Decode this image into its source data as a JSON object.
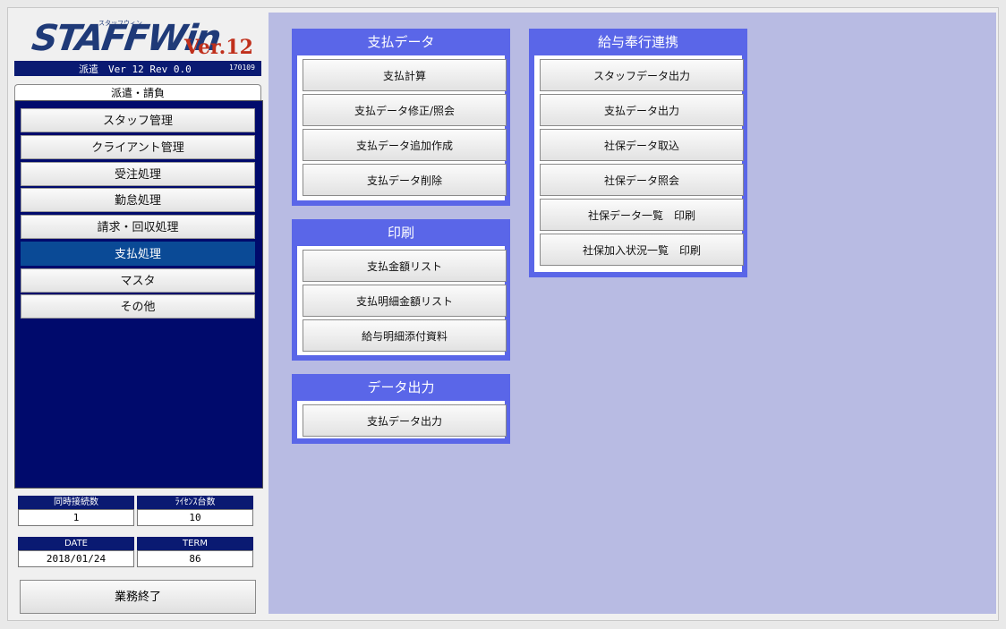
{
  "logo": {
    "main": "STAFFWin",
    "kana": "スタッフウィン",
    "version": "Ver.12"
  },
  "version_bar": {
    "text": "派遣　Ver 12 Rev 0.0",
    "build": "170109"
  },
  "sidebar": {
    "tab_label": "派遣・請負",
    "items": [
      {
        "label": "スタッフ管理"
      },
      {
        "label": "クライアント管理"
      },
      {
        "label": "受注処理"
      },
      {
        "label": "勤怠処理"
      },
      {
        "label": "請求・回収処理"
      },
      {
        "label": "支払処理"
      },
      {
        "label": "マスタ"
      },
      {
        "label": "その他"
      }
    ],
    "active_index": 5
  },
  "status": {
    "connections_label": "同時接続数",
    "connections_value": "1",
    "licenses_label": "ﾗｲｾﾝｽ台数",
    "licenses_value": "10",
    "date_label": "DATE",
    "date_value": "2018/01/24",
    "term_label": "TERM",
    "term_value": "86"
  },
  "exit_button": "業務終了",
  "groups": {
    "payment_data": {
      "title": "支払データ",
      "buttons": [
        "支払計算",
        "支払データ修正/照会",
        "支払データ追加作成",
        "支払データ削除"
      ]
    },
    "print": {
      "title": "印刷",
      "buttons": [
        "支払金額リスト",
        "支払明細金額リスト",
        "給与明細添付資料"
      ]
    },
    "data_output": {
      "title": "データ出力",
      "buttons": [
        "支払データ出力"
      ]
    },
    "payroll_link": {
      "title": "給与奉行連携",
      "buttons": [
        "スタッフデータ出力",
        "支払データ出力",
        "社保データ取込",
        "社保データ照会",
        "社保データ一覧　印刷",
        "社保加入状況一覧　印刷"
      ]
    }
  },
  "colors": {
    "sidebar_bg": "#000a6c",
    "active_item": "#0a4a96",
    "main_bg": "#b8bbe3",
    "group_header": "#5a66e8",
    "version_ver": "#c0301c"
  }
}
